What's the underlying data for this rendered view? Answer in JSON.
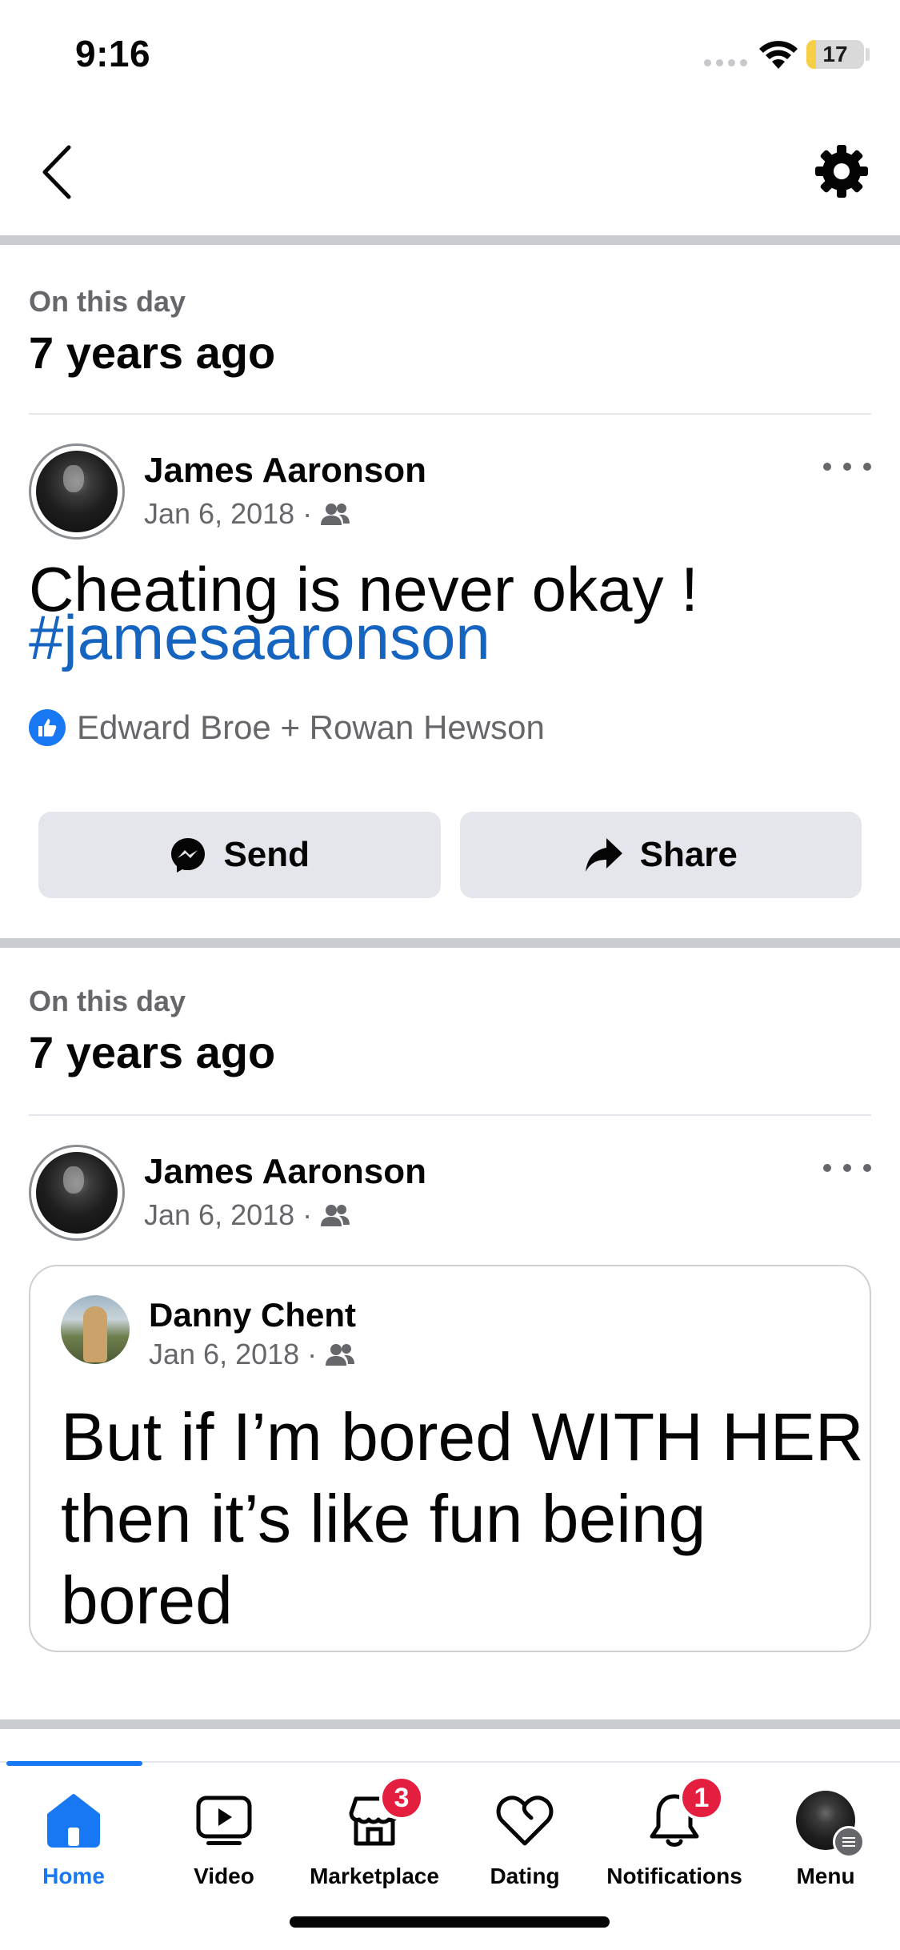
{
  "status_bar": {
    "time": "9:16",
    "battery_level": "17",
    "battery_fraction": 0.17,
    "battery_color": "#f7ce45"
  },
  "top_bar": {
    "back_icon": "chevron-left-icon",
    "settings_icon": "gear-icon"
  },
  "memories": [
    {
      "subtitle": "On this day",
      "title": "7 years ago",
      "author": "James Aaronson",
      "date": "Jan 6, 2018",
      "separator": "·",
      "audience_icon": "friends-icon",
      "text_line_1": "Cheating is never okay !",
      "hashtag": "#jamesaaronson",
      "reactions": "Edward Broe + Rowan Hewson",
      "send_label": "Send",
      "share_label": "Share"
    },
    {
      "subtitle": "On this day",
      "title": "7 years ago",
      "author": "James Aaronson",
      "date": "Jan 6, 2018",
      "separator": "·",
      "audience_icon": "friends-icon",
      "shared": {
        "author": "Danny Chent",
        "date": "Jan 6, 2018",
        "separator": "·",
        "text_lines": [
          "But if I’m bored WITH HER",
          "then it’s like fun being",
          "bored"
        ]
      }
    }
  ],
  "bottom_nav": {
    "items": [
      {
        "label": "Home",
        "icon": "home-icon",
        "active": true
      },
      {
        "label": "Video",
        "icon": "video-icon"
      },
      {
        "label": "Marketplace",
        "icon": "marketplace-icon",
        "badge": "3"
      },
      {
        "label": "Dating",
        "icon": "dating-heart-icon"
      },
      {
        "label": "Notifications",
        "icon": "bell-icon",
        "badge": "1"
      },
      {
        "label": "Menu",
        "icon": "menu-avatar"
      }
    ]
  },
  "colors": {
    "accent": "#1877f2",
    "hashtag": "#1565c0",
    "badge": "#e41e3f",
    "secondary_text": "#65676b",
    "button_bg": "#e4e6eb"
  }
}
